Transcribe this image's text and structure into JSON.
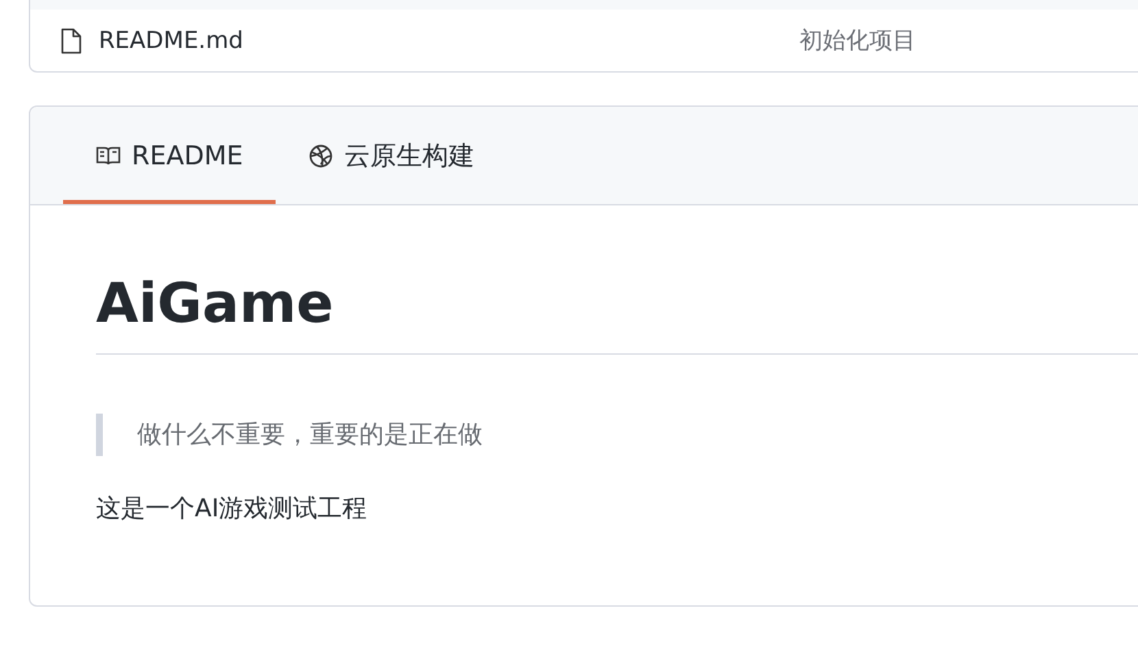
{
  "files": [
    {
      "name": "README.md",
      "message": "初始化项目"
    }
  ],
  "tabs": [
    {
      "label": "README",
      "selected": true
    },
    {
      "label": "云原生构建",
      "selected": false
    }
  ],
  "readme": {
    "title": "AiGame",
    "quote": "做什么不重要，重要的是正在做",
    "paragraph": "这是一个AI游戏测试工程"
  }
}
